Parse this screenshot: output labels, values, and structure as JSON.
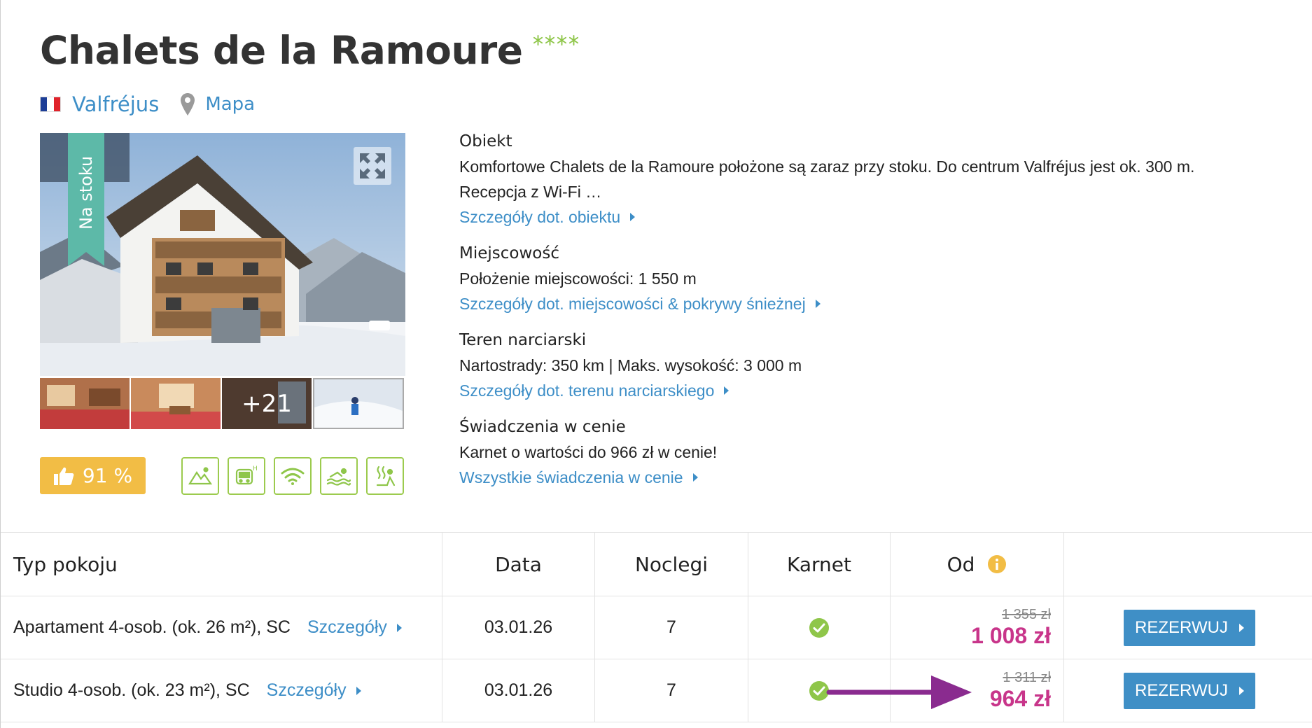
{
  "hotel": {
    "name": "Chalets de la Ramoure",
    "location": "Valfréjus",
    "map_label": "Mapa",
    "flag_colors": [
      "#1d3e97",
      "#ffffff",
      "#e0232b"
    ],
    "star_color": "#8fc64a"
  },
  "gallery": {
    "ribbon_label": "Na stoku",
    "more_photos": "+21"
  },
  "rating": {
    "value": "91 %",
    "color": "#f2bd45"
  },
  "amenities": [
    "mountain-view-icon",
    "shuttle-bus-icon",
    "wifi-icon",
    "swimming-pool-icon",
    "sauna-icon"
  ],
  "description": {
    "object": {
      "title": "Obiekt",
      "text_line1": "Komfortowe Chalets de la Ramoure położone są zaraz przy stoku. Do centrum Valfréjus jest ok. 300 m.",
      "text_line2": "Recepcja z Wi-Fi …",
      "link": "Szczegóły dot. obiektu"
    },
    "resort": {
      "title": "Miejscowość",
      "text": "Położenie miejscowości: 1 550 m",
      "link": "Szczegóły dot. miejscowości & pokrywy śnieżnej"
    },
    "ski_area": {
      "title": "Teren narciarski",
      "text": "Nartostrady: 350 km | Maks. wysokość: 3 000 m",
      "link": "Szczegóły dot. terenu narciarskiego"
    },
    "included": {
      "title": "Świadczenia w cenie",
      "text": "Karnet o wartości do 966 zł w cenie!",
      "link": "Wszystkie świadczenia w cenie"
    }
  },
  "table": {
    "headers": {
      "room_type": "Typ pokoju",
      "date": "Data",
      "nights": "Noclegi",
      "ski_pass": "Karnet",
      "from": "Od"
    },
    "rows": [
      {
        "room": "Apartament 4-osob. (ok. 26 m²), SC",
        "details": "Szczegóły",
        "date": "03.01.26",
        "nights": "7",
        "old_price": "1 355 zł",
        "price": "1 008 zł",
        "button": "REZERWUJ"
      },
      {
        "room": "Studio 4-osob. (ok. 23 m²), SC",
        "details": "Szczegóły",
        "date": "03.01.26",
        "nights": "7",
        "old_price": "1 311 zł",
        "price": "964 zł",
        "button": "REZERWUJ"
      }
    ],
    "accent_price_color": "#c8358a",
    "button_color": "#3f8fc6",
    "annotation_arrow_color": "#8a2b8f"
  }
}
